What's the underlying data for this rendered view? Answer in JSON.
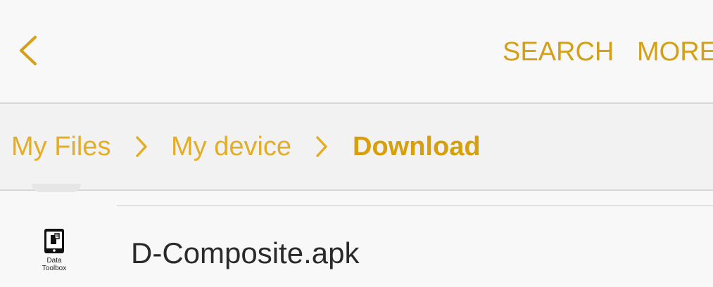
{
  "toolbar": {
    "back_icon": "chevron-left-icon",
    "search_label": "SEARCH",
    "more_label": "MORE"
  },
  "breadcrumb": {
    "items": [
      {
        "label": "My Files"
      },
      {
        "label": "My device"
      },
      {
        "label": "Download"
      }
    ],
    "separator_icon": "chevron-right-icon"
  },
  "files": [
    {
      "name": "D-Composite.apk",
      "icon": "data-toolbox-app-icon",
      "icon_caption_line1": "Data",
      "icon_caption_line2": "Toolbox"
    }
  ],
  "colors": {
    "accent": "#d4a017",
    "breadcrumb": "#e3ad25",
    "breadcrumb_active": "#d89f0c",
    "text": "#2a2a2a"
  }
}
